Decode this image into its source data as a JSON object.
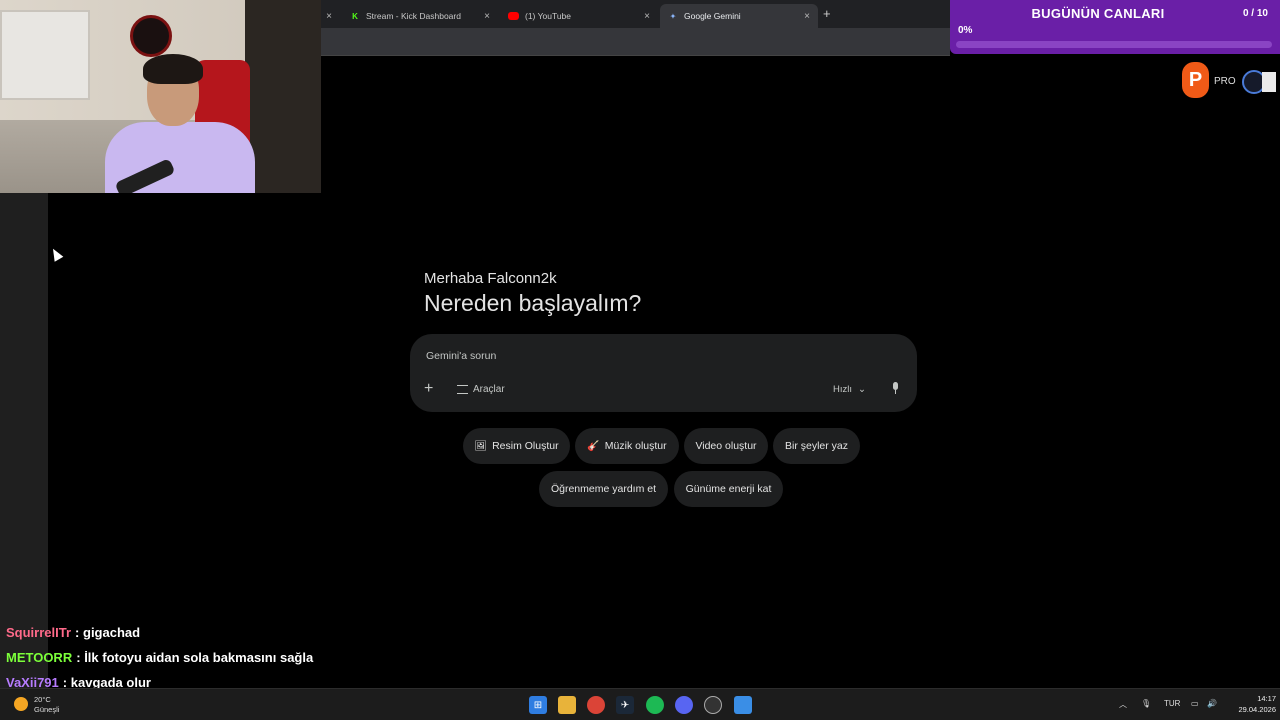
{
  "browser": {
    "tabs": [
      {
        "label": "",
        "active": false
      },
      {
        "label": "",
        "active": false
      },
      {
        "label": "Stream - Kick Dashboard",
        "active": false
      },
      {
        "label": "(1) YouTube",
        "active": false
      },
      {
        "label": "Google Gemini",
        "active": true
      }
    ],
    "new_tab": "+",
    "close": "×"
  },
  "goal_widget": {
    "title": "BUGÜNÜN CANLARI",
    "count": "0 / 10",
    "percent_label": "0%",
    "progress": 0
  },
  "gemini": {
    "greeting": "Merhaba Falconn2k",
    "headline": "Nereden başlayalım?",
    "prompt_placeholder": "Gemini'a sorun",
    "add": "+",
    "tools_label": "Araçlar",
    "mode_label": "Hızlı",
    "mode_chevron": "⌄",
    "chips_row1": [
      {
        "emoji": "🖼",
        "label": "Resim Oluştur"
      },
      {
        "emoji": "🎸",
        "label": "Müzik oluştur"
      },
      {
        "emoji": "",
        "label": "Video oluştur"
      },
      {
        "emoji": "",
        "label": "Bir şeyler yaz"
      }
    ],
    "chips_row2": [
      {
        "label": "Öğrenmeme yardım et"
      },
      {
        "label": "Günüme enerji kat"
      }
    ]
  },
  "overlay_logos": {
    "p_logo": "P",
    "pro_text": "PRO"
  },
  "chat": [
    {
      "user": "SquirrelITr",
      "sep": ":",
      "message": "gigachad",
      "color": "#ff6a8a"
    },
    {
      "user": "METOORR",
      "sep": ":",
      "message": "İlk fotoyu aidan sola bakmasını sağla",
      "color": "#7cff3a"
    },
    {
      "user": "VaXii791",
      "sep": ":",
      "message": "kavgada olur",
      "color": "#b77cff"
    }
  ],
  "taskbar": {
    "weather_temp": "20°C",
    "weather_desc": "Güneşli",
    "lang": "TUR",
    "time": "14:17",
    "date": "29.04.2026",
    "apps": [
      "start-icon",
      "file-explorer-icon",
      "chrome-icon",
      "steam-icon",
      "spotify-icon",
      "discord-icon",
      "obs-icon",
      "paint-icon"
    ]
  }
}
